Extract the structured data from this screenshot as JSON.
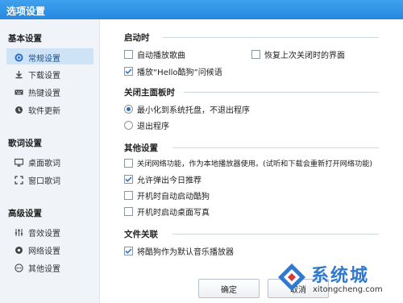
{
  "window": {
    "title": "选项设置"
  },
  "sidebar": {
    "groups": [
      {
        "title": "基本设置",
        "items": [
          {
            "label": "常规设置",
            "icon": "gear-icon",
            "active": true
          },
          {
            "label": "下载设置",
            "icon": "download-icon",
            "active": false
          },
          {
            "label": "热键设置",
            "icon": "keyboard-icon",
            "active": false
          },
          {
            "label": "软件更新",
            "icon": "refresh-icon",
            "active": false
          }
        ]
      },
      {
        "title": "歌词设置",
        "items": [
          {
            "label": "桌面歌词",
            "icon": "monitor-icon",
            "active": false
          },
          {
            "label": "窗口歌词",
            "icon": "window-icon",
            "active": false
          }
        ]
      },
      {
        "title": "高级设置",
        "items": [
          {
            "label": "音效设置",
            "icon": "equalizer-icon",
            "active": false
          },
          {
            "label": "网络设置",
            "icon": "network-icon",
            "active": false
          },
          {
            "label": "其他设置",
            "icon": "more-icon",
            "active": false
          }
        ]
      }
    ]
  },
  "main": {
    "startup": {
      "title": "启动时",
      "auto_play": {
        "label": "自动播放歌曲",
        "checked": false
      },
      "restore": {
        "label": "恢复上次关闭时的界面",
        "checked": false
      },
      "greeting": {
        "label": "播放“Hello酷狗”问候语",
        "checked": true
      }
    },
    "close_panel": {
      "title": "关闭主面板时",
      "minimize": {
        "label": "最小化到系统托盘，不退出程序",
        "selected": true
      },
      "exit": {
        "label": "退出程序",
        "selected": false
      }
    },
    "other": {
      "title": "其他设置",
      "offline": {
        "label": "关闭网络功能，作为本地播放器使用。(试听和下载会重新打开网络功能)",
        "checked": false
      },
      "daily_push": {
        "label": "允许弹出今日推荐",
        "checked": true
      },
      "autostart": {
        "label": "开机时自动启动酷狗",
        "checked": false
      },
      "desktop_wallpaper": {
        "label": "开机时启动桌面写真",
        "checked": false
      }
    },
    "file_assoc": {
      "title": "文件关联",
      "default_player": {
        "label": "将酷狗作为默认音乐播放器",
        "checked": true
      }
    }
  },
  "footer": {
    "ok_label": "确定",
    "cancel_label": "取消"
  },
  "watermark": {
    "title": "系统城",
    "url": "xitongcheng.com"
  },
  "colors": {
    "titlebar": "#2f8ee6",
    "sidebar_bg": "#f0f4f9",
    "active_item": "#cfe3f7",
    "check": "#2b6fc4"
  }
}
